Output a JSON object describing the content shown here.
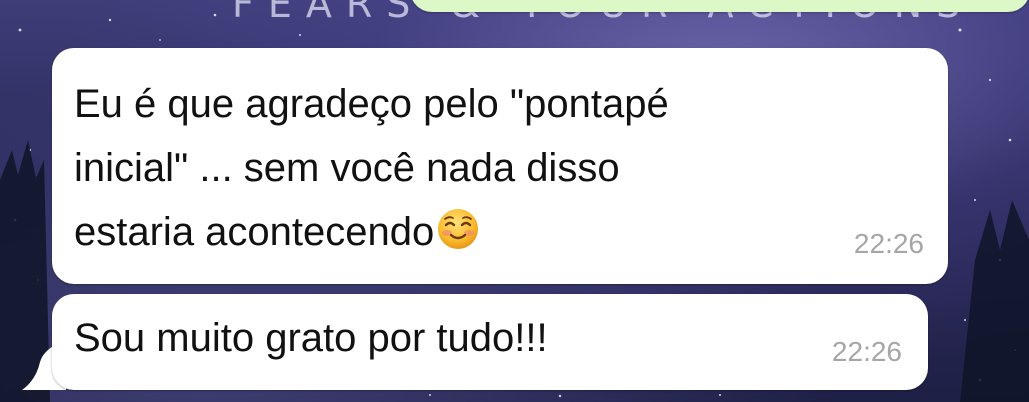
{
  "wallpaper": {
    "text": "FEARS & YOUR ACTIONS"
  },
  "colors": {
    "incoming_bubble": "#ffffff",
    "outgoing_bubble": "#dcf8c6",
    "timestamp": "#a6a6a6",
    "message_text": "#111111"
  },
  "messages": [
    {
      "text": "Eu é que agradeço pelo \"pontapé\ninicial\" ... sem você nada disso\nestaria acontecendo",
      "emoji": "smiling-face-icon",
      "time": "22:26"
    },
    {
      "text": "Sou muito grato por tudo!!!",
      "time": "22:26"
    }
  ]
}
